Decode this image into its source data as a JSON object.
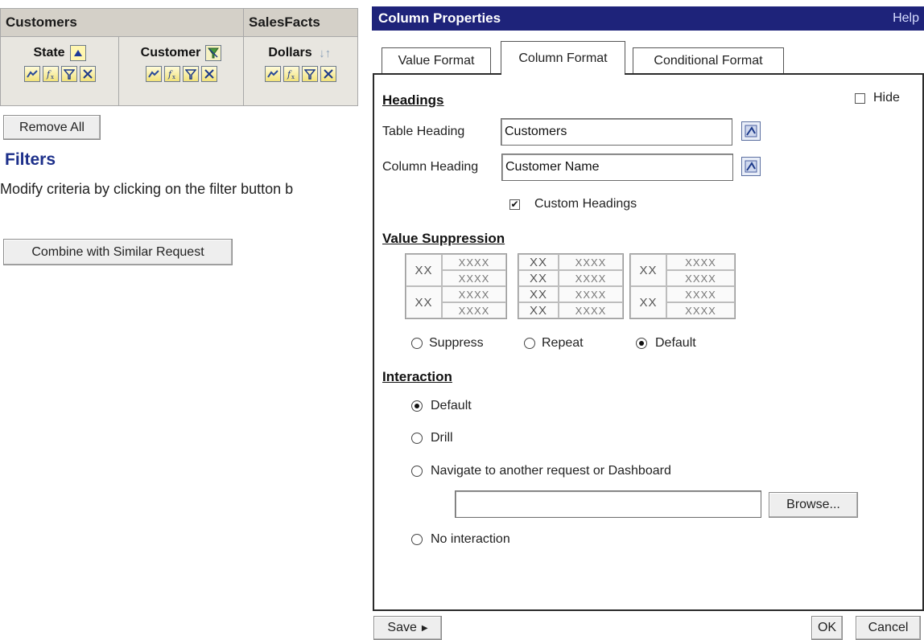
{
  "criteria": {
    "groups": {
      "customers": "Customers",
      "salesfacts": "SalesFacts"
    },
    "columns": [
      {
        "name": "State"
      },
      {
        "name": "Customer"
      },
      {
        "name": "Dollars"
      }
    ],
    "remove_all_label": "Remove All",
    "filters_title": "Filters",
    "filters_desc": "Modify criteria by clicking on the filter button b",
    "combine_label": "Combine with Similar Request"
  },
  "dialog": {
    "title": "Column Properties",
    "help": "Help",
    "tabs": [
      "Value Format",
      "Column Format",
      "Conditional Format"
    ],
    "active_tab": "Column Format",
    "hide_label": "Hide",
    "headings": {
      "title": "Headings",
      "table_heading_label": "Table Heading",
      "table_heading_value": "Customers",
      "column_heading_label": "Column Heading",
      "column_heading_value": "Customer Name",
      "custom_headings_label": "Custom Headings",
      "custom_headings_checked": true
    },
    "value_suppression": {
      "title": "Value Suppression",
      "cell_big": "XX",
      "cell_small": "XXXX",
      "options": [
        "Suppress",
        "Repeat",
        "Default"
      ],
      "selected": "Default"
    },
    "interaction": {
      "title": "Interaction",
      "options": [
        "Default",
        "Drill",
        "Navigate to another request or Dashboard",
        "No interaction"
      ],
      "selected": "Default",
      "navigate_value": "",
      "browse_label": "Browse..."
    },
    "footer": {
      "save_label": "Save",
      "ok_label": "OK",
      "cancel_label": "Cancel"
    }
  },
  "icons": [
    "sort-ascending-icon",
    "sort-icon",
    "format-icon",
    "formula-icon",
    "filter-icon",
    "delete-icon",
    "customer-column-icon",
    "edit-format-icon",
    "arrow-right-icon"
  ]
}
